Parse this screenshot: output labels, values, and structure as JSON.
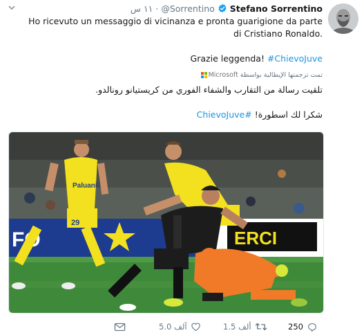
{
  "tweet": {
    "author_name": "Stefano Sorrentino",
    "handle": "@Sorrentino",
    "separator": "·",
    "time": "١١ س",
    "text_line1": "Ho ricevuto un messaggio di vicinanza e pronta guarigione da parte di Cristiano Ronaldo.",
    "text_line2": "Grazie leggenda!",
    "text_hashtag": "#ChievoJuve",
    "translated_by": "تمت ترجمتها الإيطالية بواسطة",
    "translator": "Microsoft",
    "translated_line1": "تلقيت رسالة من التقارب والشفاء الفوري من كريستيانو رونالدو.",
    "translated_line2": "شكرا لك اسطورة!",
    "translated_hashtag": "#ChievoJuve"
  },
  "photo": {
    "banner_text": "ERCI",
    "banner_left_text": "FO",
    "player_number": "29"
  },
  "actions": {
    "replies": "250",
    "retweets": "1.5 ألف",
    "likes": "5.0 آلف"
  },
  "colors": {
    "link": "#1b95e0",
    "verified": "#1da1f2",
    "muted": "#657786",
    "chievo_yellow": "#f3e11f",
    "chievo_blue": "#1d3c8f",
    "juve_black": "#1c1c1c",
    "keeper_orange": "#f07a27",
    "pitch_green": "#3f8a3a"
  }
}
